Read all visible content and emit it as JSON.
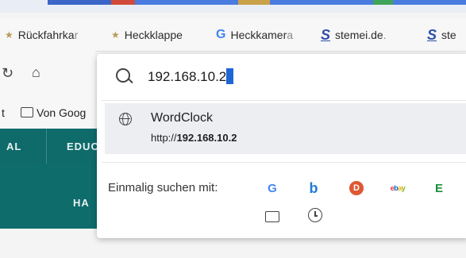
{
  "bookmarks_bar": {
    "items": [
      {
        "label": "Rückfahrka",
        "fade": "r"
      },
      {
        "label": "Heckklappe",
        "fade": ""
      },
      {
        "label": "Heckkamer",
        "fade": "a"
      },
      {
        "label": "stemei.de",
        "fade": "."
      },
      {
        "label": "ste",
        "fade": ""
      }
    ]
  },
  "left": {
    "bookmark_folder_label": "Von Goog",
    "bookmark_prefix": "t"
  },
  "site_nav": {
    "item1": "AL",
    "item2": "EDUC",
    "item3": "HA"
  },
  "omnibox": {
    "value": "192.168.10.2"
  },
  "suggestion": {
    "title": "WordClock",
    "url_prefix": "http://",
    "url_host": "192.168.10.2"
  },
  "search_engines": {
    "label": "Einmalig suchen mit:"
  },
  "colors": {
    "teal": "#0f6b6a",
    "caret": "#1e66d6"
  }
}
